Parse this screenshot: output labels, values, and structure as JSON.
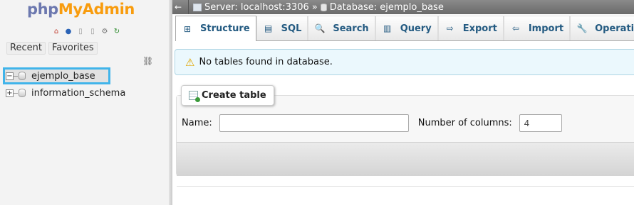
{
  "app": {
    "logo_php": "php",
    "logo_myadmin": "MyAdmin"
  },
  "nav": {
    "icons": [
      "home-icon",
      "info-icon",
      "docs-icon",
      "settings-icon",
      "reload-icon"
    ],
    "recent_label": "Recent",
    "favorites_label": "Favorites",
    "databases": [
      {
        "name": "ejemplo_base",
        "expander": "−",
        "selected": true
      },
      {
        "name": "information_schema",
        "expander": "+",
        "selected": false
      }
    ]
  },
  "breadcrumb": {
    "back": "←",
    "server": "Server: localhost:3306",
    "separator": "»",
    "database": "Database: ejemplo_base"
  },
  "tabs": [
    {
      "label": "Structure",
      "icon": "structure-icon",
      "glyph": "⊞",
      "active": true
    },
    {
      "label": "SQL",
      "icon": "sql-icon",
      "glyph": "▤",
      "active": false
    },
    {
      "label": "Search",
      "icon": "search-icon",
      "glyph": "🔍",
      "active": false
    },
    {
      "label": "Query",
      "icon": "query-icon",
      "glyph": "▥",
      "active": false
    },
    {
      "label": "Export",
      "icon": "export-icon",
      "glyph": "⇨",
      "active": false
    },
    {
      "label": "Import",
      "icon": "import-icon",
      "glyph": "⇦",
      "active": false
    },
    {
      "label": "Operations",
      "icon": "wrench-icon",
      "glyph": "🔧",
      "active": false
    }
  ],
  "notice": {
    "text": "No tables found in database."
  },
  "create_table": {
    "legend": "Create table",
    "name_label": "Name:",
    "name_value": "",
    "columns_label": "Number of columns:",
    "columns_value": "4"
  }
}
